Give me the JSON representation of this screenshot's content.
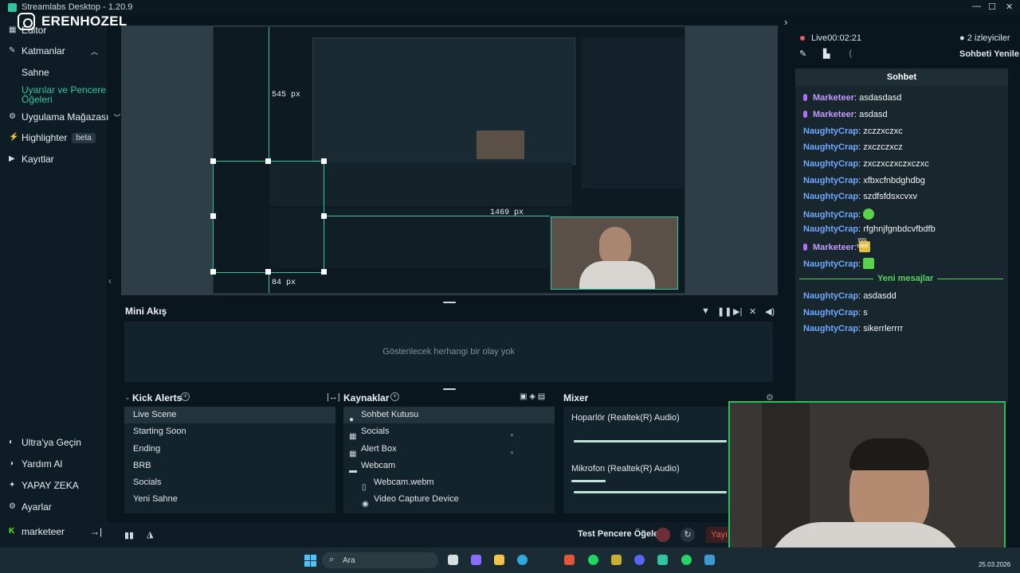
{
  "window": {
    "title": "Streamlabs Desktop - 1.20.9"
  },
  "watermark": {
    "text": "ERENHOZEL"
  },
  "sidebar": {
    "editor_label": "Editor",
    "layers_label": "Katmanlar",
    "sub_items": [
      "Sahne",
      "Uyarılar ve Pencere",
      "Öğeleri"
    ],
    "app_store_label": "Uygulama Mağazası",
    "highlighter_label": "Highlighter",
    "highlighter_badge": "beta",
    "recordings_label": "Kayıtlar",
    "ultra_label": "Ultra'ya Geçin",
    "help_label": "Yardım Al",
    "ai_label": "YAPAY ZEKA",
    "settings_label": "Ayarlar",
    "user_label": "marketeer"
  },
  "preview": {
    "px_top": "545 px",
    "px_right": "1469 px",
    "px_bottom": "84 px"
  },
  "mini_feed": {
    "title": "Mini Akış",
    "empty_text": "Gösterilecek herhangi bir olay yok"
  },
  "scenes": {
    "title": "Kick Alerts",
    "items": [
      "Live Scene",
      "Starting Soon",
      "Ending",
      "BRB",
      "Socials",
      "Yeni Sahne"
    ]
  },
  "sources": {
    "title": "Kaynaklar",
    "items": [
      "Sohbet Kutusu",
      "Socials",
      "Alert Box",
      "Webcam",
      "Webcam.webm",
      "Video Capture Device"
    ]
  },
  "mixer": {
    "title": "Mixer",
    "channels": [
      {
        "name": "Hoparlör (Realtek(R) Audio)",
        "level": 0.98
      },
      {
        "name": "Mikrofon (Realtek(R) Audio)",
        "level": 0.2
      }
    ]
  },
  "footer": {
    "test_label": "Test Pencere Öğeleri",
    "go_live_label": "Yayı"
  },
  "chat": {
    "live_label": "Live",
    "live_time": "00:02:21",
    "viewers": "2 izleyiciler",
    "refresh_label": "Sohbeti Yenile",
    "header": "Sohbet",
    "new_messages": "Yeni mesajlar",
    "messages": [
      {
        "user": "Marketeer",
        "text": "asdasdasd"
      },
      {
        "user": "Marketeer",
        "text": "asdasd"
      },
      {
        "user": "NaughtyCrap",
        "text": "zczzxczxc"
      },
      {
        "user": "NaughtyCrap",
        "text": "zxczczxcz"
      },
      {
        "user": "NaughtyCrap",
        "text": "zxczxczxczxczxc"
      },
      {
        "user": "NaughtyCrap",
        "text": "xfbxcfnbdghdbg"
      },
      {
        "user": "NaughtyCrap",
        "text": "szdfsfdsxcvxv"
      },
      {
        "user": "NaughtyCrap",
        "text": ""
      },
      {
        "user": "NaughtyCrap",
        "text": "rfghnjfgnbdcvfbdfb"
      },
      {
        "user": "Marketeer",
        "text": ""
      },
      {
        "user": "NaughtyCrap",
        "text": ""
      },
      {
        "user": "NaughtyCrap",
        "text": "asdasdd"
      },
      {
        "user": "NaughtyCrap",
        "text": "s"
      },
      {
        "user": "NaughtyCrap",
        "text": "sikerrlerrrr"
      }
    ],
    "emote_label": "you tried"
  },
  "taskbar": {
    "search_placeholder": "Ara",
    "date": "25.03.2026"
  },
  "colors": {
    "accent": "#31c3a2",
    "live": "#e25d61",
    "new_messages": "#54d35c",
    "chat_user": "#6fa8ff",
    "chat_mod": "#c39aff"
  }
}
